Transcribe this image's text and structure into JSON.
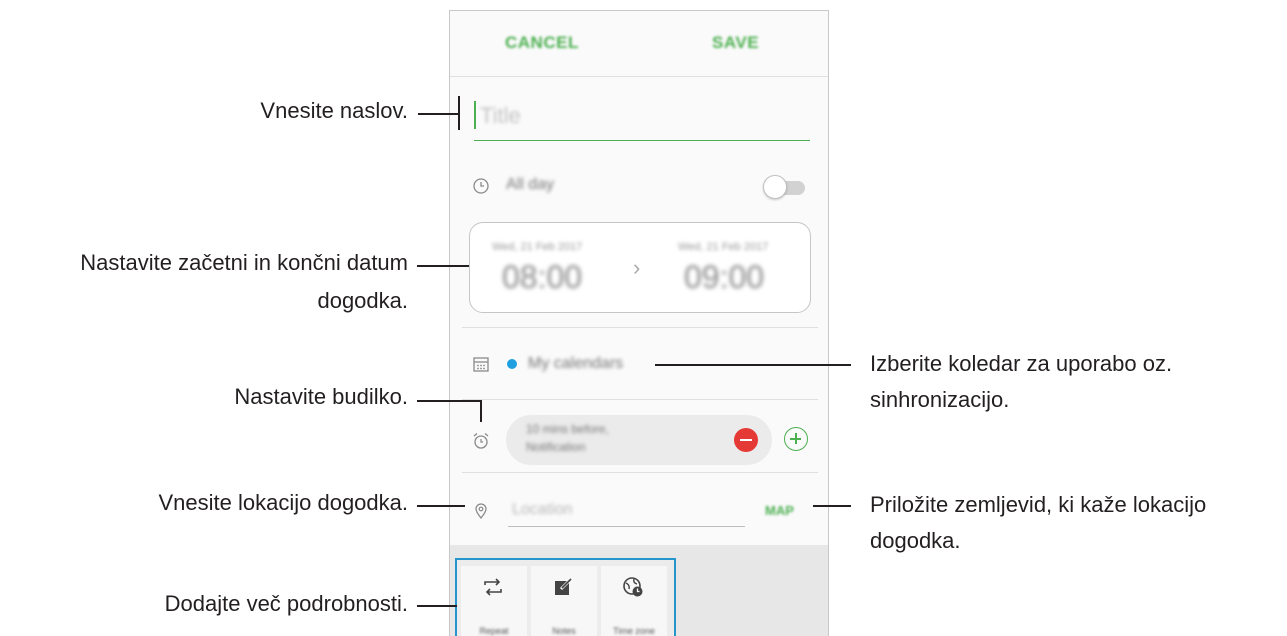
{
  "header": {
    "cancel_label": "CANCEL",
    "save_label": "SAVE"
  },
  "form": {
    "title_placeholder": "Title",
    "all_day_label": "All day",
    "start_date": "Wed, 21 Feb 2017",
    "start_time": "08:00",
    "end_date": "Wed, 21 Feb 2017",
    "end_time": "09:00",
    "calendar_name": "My calendars",
    "calendar_color": "#1e9fe0",
    "reminder_line1": "10 mins before,",
    "reminder_line2": "Notification",
    "location_placeholder": "Location",
    "map_label": "MAP",
    "all_day_enabled": false
  },
  "more_options": [
    {
      "label": "Repeat",
      "icon": "repeat-icon"
    },
    {
      "label": "Notes",
      "icon": "notes-icon"
    },
    {
      "label": "Time zone",
      "icon": "time-zone-icon"
    }
  ],
  "callouts": {
    "title": "Vnesite naslov.",
    "date_line1": "Nastavite začetni in končni datum",
    "date_line2": "dogodka.",
    "alarm": "Nastavite budilko.",
    "location": "Vnesite lokacijo dogodka.",
    "more": "Dodajte več podrobnosti.",
    "calendar_line1": "Izberite koledar za uporabo oz.",
    "calendar_line2": "sinhronizacijo.",
    "map_line1": "Priložite zemljevid, ki kaže lokacijo",
    "map_line2": "dogodka."
  },
  "colors": {
    "accent": "#4caf50",
    "highlight_frame": "#2596cc",
    "minus": "#e53935"
  }
}
